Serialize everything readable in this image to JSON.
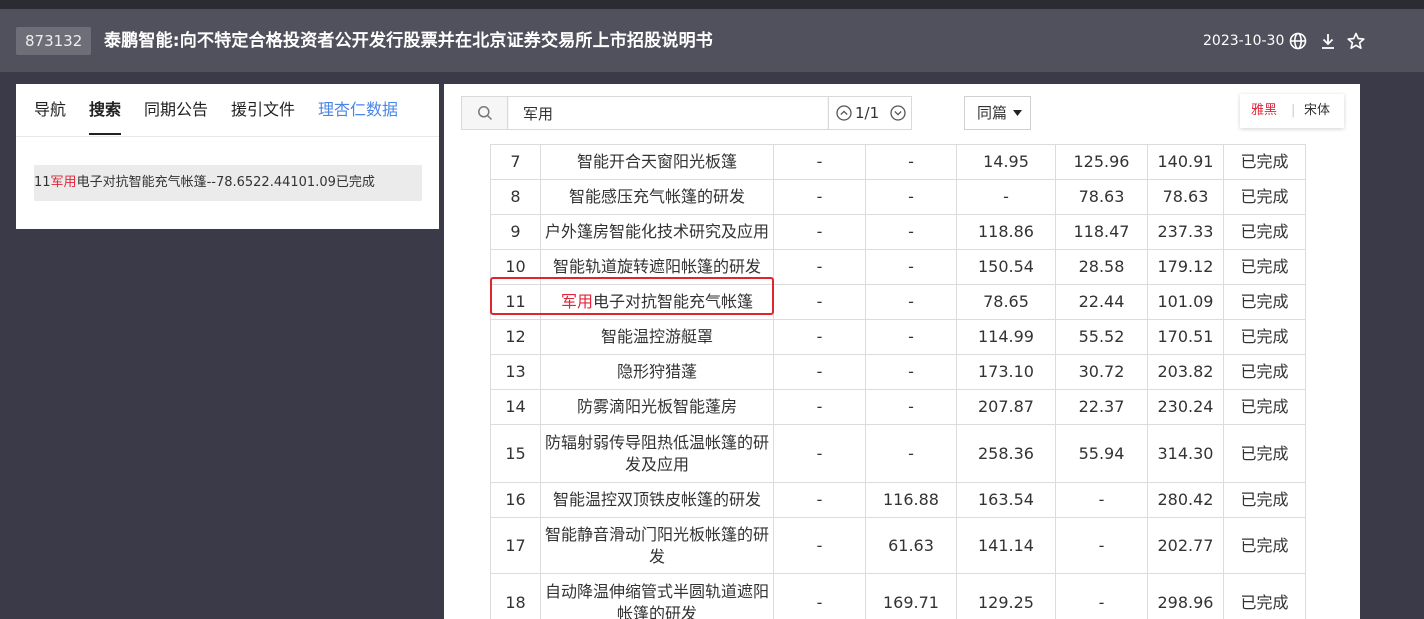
{
  "header": {
    "code": "873132",
    "title": "泰鹏智能:向不特定合格投资者公开发行股票并在北京证券交易所上市招股说明书",
    "date": "2023-10-30",
    "icons": [
      "globe-icon",
      "download-icon",
      "star-icon"
    ]
  },
  "left_panel": {
    "tabs": [
      {
        "label": "导航"
      },
      {
        "label": "搜索"
      },
      {
        "label": "同期公告"
      },
      {
        "label": "援引文件"
      },
      {
        "label": "理杏仁数据"
      }
    ],
    "active_tab": "搜索",
    "result": {
      "prefix": "11",
      "highlight": "军用",
      "suffix": "电子对抗智能充气帐篷--78.6522.44101.09已完成"
    }
  },
  "search": {
    "query": "军用",
    "count": "1/1",
    "scope": "同篇"
  },
  "font_switch": {
    "option_a": "雅黑",
    "separator": "|",
    "option_b": "宋体"
  },
  "colors": {
    "highlight": "#e0263b",
    "header_bg": "#51515d",
    "page_bg": "#3a3a48",
    "link_blue": "#4a86e8",
    "box_red": "#e0262a"
  },
  "table": {
    "rows": [
      {
        "no": "7",
        "name": "智能开合天窗阳光板篷",
        "c3": "-",
        "c4": "-",
        "c5": "14.95",
        "c6": "125.96",
        "c7": "140.91",
        "status": "已完成"
      },
      {
        "no": "8",
        "name": "智能感压充气帐篷的研发",
        "c3": "-",
        "c4": "-",
        "c5": "-",
        "c6": "78.63",
        "c7": "78.63",
        "status": "已完成"
      },
      {
        "no": "9",
        "name": "户外篷房智能化技术研究及应用",
        "c3": "-",
        "c4": "-",
        "c5": "118.86",
        "c6": "118.47",
        "c7": "237.33",
        "status": "已完成"
      },
      {
        "no": "10",
        "name": "智能轨道旋转遮阳帐篷的研发",
        "c3": "-",
        "c4": "-",
        "c5": "150.54",
        "c6": "28.58",
        "c7": "179.12",
        "status": "已完成"
      },
      {
        "no": "11",
        "name_highlight": "军用",
        "name_rest": "电子对抗智能充气帐篷",
        "c3": "-",
        "c4": "-",
        "c5": "78.65",
        "c6": "22.44",
        "c7": "101.09",
        "status": "已完成"
      },
      {
        "no": "12",
        "name": "智能温控游艇罩",
        "c3": "-",
        "c4": "-",
        "c5": "114.99",
        "c6": "55.52",
        "c7": "170.51",
        "status": "已完成"
      },
      {
        "no": "13",
        "name": "隐形狩猎蓬",
        "c3": "-",
        "c4": "-",
        "c5": "173.10",
        "c6": "30.72",
        "c7": "203.82",
        "status": "已完成"
      },
      {
        "no": "14",
        "name": "防雾滴阳光板智能蓬房",
        "c3": "-",
        "c4": "-",
        "c5": "207.87",
        "c6": "22.37",
        "c7": "230.24",
        "status": "已完成"
      },
      {
        "no": "15",
        "name": "防辐射弱传导阻热低温帐篷的研发及应用",
        "c3": "-",
        "c4": "-",
        "c5": "258.36",
        "c6": "55.94",
        "c7": "314.30",
        "status": "已完成"
      },
      {
        "no": "16",
        "name": "智能温控双顶铁皮帐篷的研发",
        "c3": "-",
        "c4": "116.88",
        "c5": "163.54",
        "c6": "-",
        "c7": "280.42",
        "status": "已完成"
      },
      {
        "no": "17",
        "name": "智能静音滑动门阳光板帐篷的研发",
        "c3": "-",
        "c4": "61.63",
        "c5": "141.14",
        "c6": "-",
        "c7": "202.77",
        "status": "已完成"
      },
      {
        "no": "18",
        "name": "自动降温伸缩管式半圆轨道遮阳帐篷的研发",
        "c3": "-",
        "c4": "169.71",
        "c5": "129.25",
        "c6": "-",
        "c7": "298.96",
        "status": "已完成"
      }
    ]
  }
}
